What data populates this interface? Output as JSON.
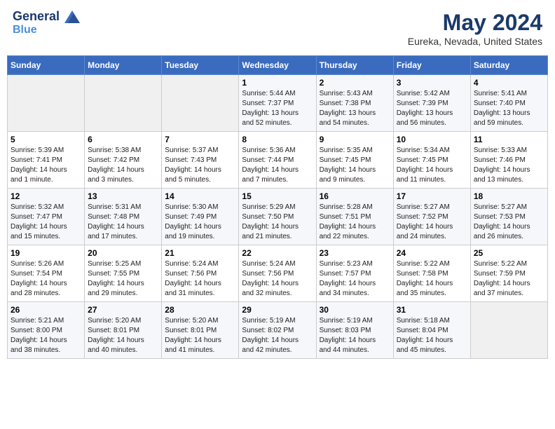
{
  "header": {
    "logo_line1": "General",
    "logo_line2": "Blue",
    "month": "May 2024",
    "location": "Eureka, Nevada, United States"
  },
  "weekdays": [
    "Sunday",
    "Monday",
    "Tuesday",
    "Wednesday",
    "Thursday",
    "Friday",
    "Saturday"
  ],
  "weeks": [
    [
      {
        "day": "",
        "info": ""
      },
      {
        "day": "",
        "info": ""
      },
      {
        "day": "",
        "info": ""
      },
      {
        "day": "1",
        "info": "Sunrise: 5:44 AM\nSunset: 7:37 PM\nDaylight: 13 hours\nand 52 minutes."
      },
      {
        "day": "2",
        "info": "Sunrise: 5:43 AM\nSunset: 7:38 PM\nDaylight: 13 hours\nand 54 minutes."
      },
      {
        "day": "3",
        "info": "Sunrise: 5:42 AM\nSunset: 7:39 PM\nDaylight: 13 hours\nand 56 minutes."
      },
      {
        "day": "4",
        "info": "Sunrise: 5:41 AM\nSunset: 7:40 PM\nDaylight: 13 hours\nand 59 minutes."
      }
    ],
    [
      {
        "day": "5",
        "info": "Sunrise: 5:39 AM\nSunset: 7:41 PM\nDaylight: 14 hours\nand 1 minute."
      },
      {
        "day": "6",
        "info": "Sunrise: 5:38 AM\nSunset: 7:42 PM\nDaylight: 14 hours\nand 3 minutes."
      },
      {
        "day": "7",
        "info": "Sunrise: 5:37 AM\nSunset: 7:43 PM\nDaylight: 14 hours\nand 5 minutes."
      },
      {
        "day": "8",
        "info": "Sunrise: 5:36 AM\nSunset: 7:44 PM\nDaylight: 14 hours\nand 7 minutes."
      },
      {
        "day": "9",
        "info": "Sunrise: 5:35 AM\nSunset: 7:45 PM\nDaylight: 14 hours\nand 9 minutes."
      },
      {
        "day": "10",
        "info": "Sunrise: 5:34 AM\nSunset: 7:45 PM\nDaylight: 14 hours\nand 11 minutes."
      },
      {
        "day": "11",
        "info": "Sunrise: 5:33 AM\nSunset: 7:46 PM\nDaylight: 14 hours\nand 13 minutes."
      }
    ],
    [
      {
        "day": "12",
        "info": "Sunrise: 5:32 AM\nSunset: 7:47 PM\nDaylight: 14 hours\nand 15 minutes."
      },
      {
        "day": "13",
        "info": "Sunrise: 5:31 AM\nSunset: 7:48 PM\nDaylight: 14 hours\nand 17 minutes."
      },
      {
        "day": "14",
        "info": "Sunrise: 5:30 AM\nSunset: 7:49 PM\nDaylight: 14 hours\nand 19 minutes."
      },
      {
        "day": "15",
        "info": "Sunrise: 5:29 AM\nSunset: 7:50 PM\nDaylight: 14 hours\nand 21 minutes."
      },
      {
        "day": "16",
        "info": "Sunrise: 5:28 AM\nSunset: 7:51 PM\nDaylight: 14 hours\nand 22 minutes."
      },
      {
        "day": "17",
        "info": "Sunrise: 5:27 AM\nSunset: 7:52 PM\nDaylight: 14 hours\nand 24 minutes."
      },
      {
        "day": "18",
        "info": "Sunrise: 5:27 AM\nSunset: 7:53 PM\nDaylight: 14 hours\nand 26 minutes."
      }
    ],
    [
      {
        "day": "19",
        "info": "Sunrise: 5:26 AM\nSunset: 7:54 PM\nDaylight: 14 hours\nand 28 minutes."
      },
      {
        "day": "20",
        "info": "Sunrise: 5:25 AM\nSunset: 7:55 PM\nDaylight: 14 hours\nand 29 minutes."
      },
      {
        "day": "21",
        "info": "Sunrise: 5:24 AM\nSunset: 7:56 PM\nDaylight: 14 hours\nand 31 minutes."
      },
      {
        "day": "22",
        "info": "Sunrise: 5:24 AM\nSunset: 7:56 PM\nDaylight: 14 hours\nand 32 minutes."
      },
      {
        "day": "23",
        "info": "Sunrise: 5:23 AM\nSunset: 7:57 PM\nDaylight: 14 hours\nand 34 minutes."
      },
      {
        "day": "24",
        "info": "Sunrise: 5:22 AM\nSunset: 7:58 PM\nDaylight: 14 hours\nand 35 minutes."
      },
      {
        "day": "25",
        "info": "Sunrise: 5:22 AM\nSunset: 7:59 PM\nDaylight: 14 hours\nand 37 minutes."
      }
    ],
    [
      {
        "day": "26",
        "info": "Sunrise: 5:21 AM\nSunset: 8:00 PM\nDaylight: 14 hours\nand 38 minutes."
      },
      {
        "day": "27",
        "info": "Sunrise: 5:20 AM\nSunset: 8:01 PM\nDaylight: 14 hours\nand 40 minutes."
      },
      {
        "day": "28",
        "info": "Sunrise: 5:20 AM\nSunset: 8:01 PM\nDaylight: 14 hours\nand 41 minutes."
      },
      {
        "day": "29",
        "info": "Sunrise: 5:19 AM\nSunset: 8:02 PM\nDaylight: 14 hours\nand 42 minutes."
      },
      {
        "day": "30",
        "info": "Sunrise: 5:19 AM\nSunset: 8:03 PM\nDaylight: 14 hours\nand 44 minutes."
      },
      {
        "day": "31",
        "info": "Sunrise: 5:18 AM\nSunset: 8:04 PM\nDaylight: 14 hours\nand 45 minutes."
      },
      {
        "day": "",
        "info": ""
      }
    ]
  ]
}
